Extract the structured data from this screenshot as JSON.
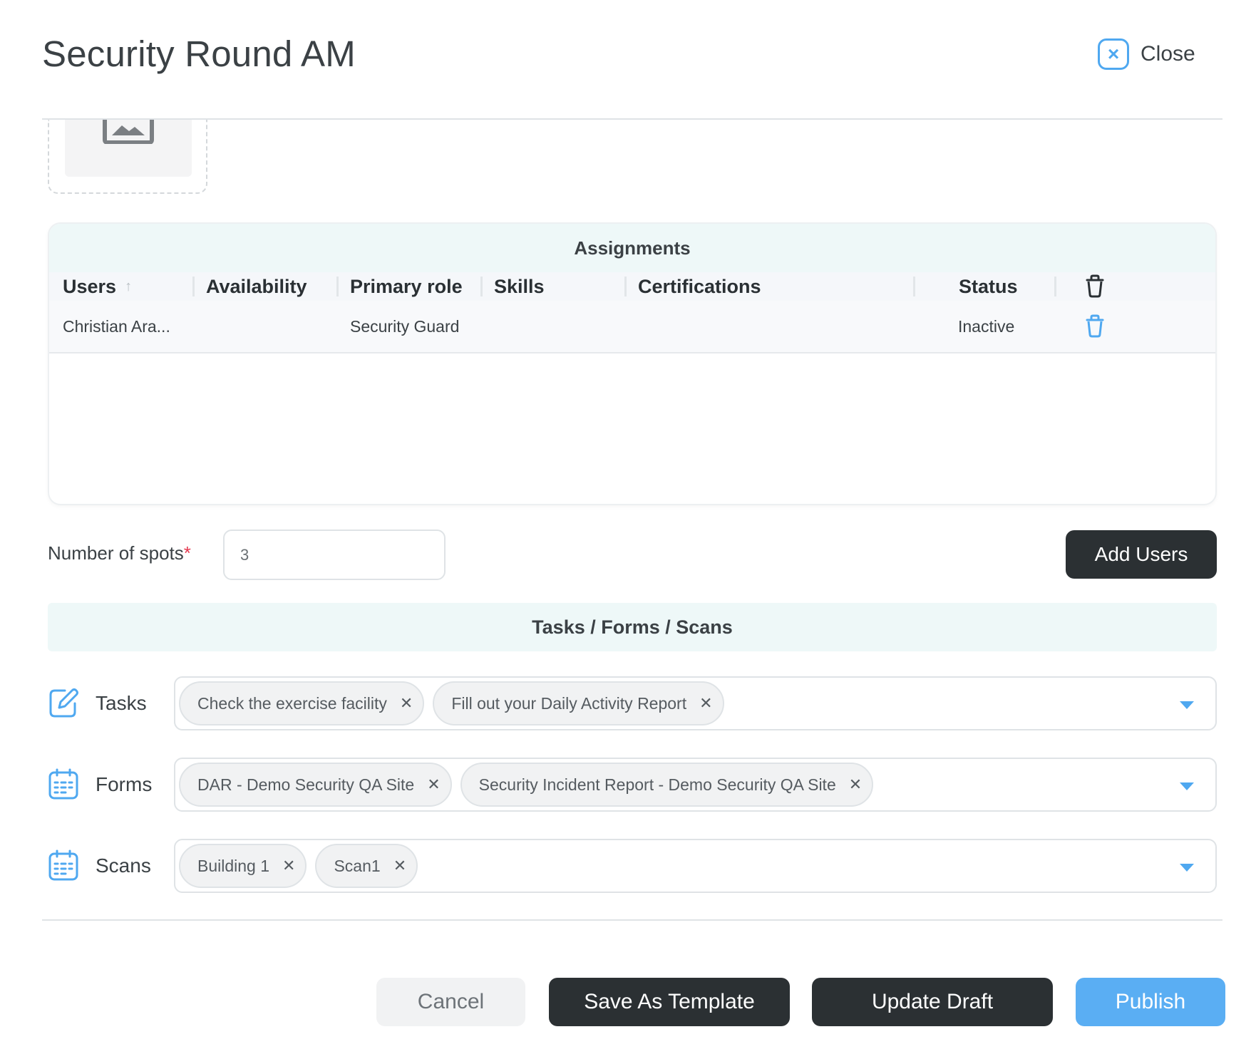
{
  "header": {
    "title": "Security Round AM",
    "close_label": "Close"
  },
  "assignments": {
    "title": "Assignments",
    "columns": [
      "Users",
      "Availability",
      "Primary role",
      "Skills",
      "Certifications",
      "Status"
    ],
    "rows": [
      {
        "user": "Christian Ara...",
        "availability": "",
        "primary_role": "Security Guard",
        "skills": "",
        "certifications": "",
        "status": "Inactive"
      }
    ]
  },
  "spots": {
    "label": "Number of spots",
    "required_mark": "*",
    "value": "3"
  },
  "add_users_label": "Add Users",
  "tfs": {
    "title": "Tasks / Forms / Scans",
    "tasks": {
      "label": "Tasks",
      "items": [
        "Check the exercise facility",
        "Fill out your Daily Activity Report"
      ]
    },
    "forms": {
      "label": "Forms",
      "items": [
        "DAR - Demo Security QA Site",
        "Security Incident Report - Demo Security QA Site"
      ]
    },
    "scans": {
      "label": "Scans",
      "items": [
        "Building 1",
        "Scan1"
      ]
    }
  },
  "footer": {
    "cancel": "Cancel",
    "save_template": "Save As Template",
    "update_draft": "Update Draft",
    "publish": "Publish"
  },
  "colors": {
    "accent": "#4fa8f0",
    "primary_dark": "#2b3033",
    "publish": "#5aaef3",
    "section_header_bg": "#eef8f8",
    "required": "#e53950"
  },
  "icons": {
    "close": "close-icon",
    "image_placeholder": "image-icon",
    "sort": "sort-arrow-up-icon",
    "trash": "trash-icon",
    "tasks": "pencil-edit-icon",
    "forms": "calendar-icon",
    "scans": "calendar-icon",
    "chip_remove": "x-icon",
    "dropdown": "caret-down-icon"
  }
}
